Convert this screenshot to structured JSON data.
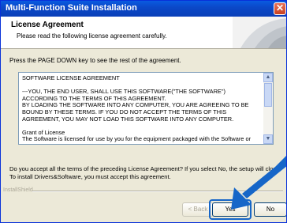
{
  "window": {
    "title": "Multi-Function Suite Installation",
    "close_glyph": "✕"
  },
  "header": {
    "title": "License Agreement",
    "subtitle": "Please read the following license agreement carefully."
  },
  "instruction": "Press the PAGE DOWN key to see the rest of the agreement.",
  "license_text": "SOFTWARE LICENSE AGREEMENT\n\n---YOU, THE END USER, SHALL USE THIS SOFTWARE(\"THE SOFTWARE\")\nACCORDING TO THE TERMS OF THIS AGREEMENT.\nBY LOADING THE SOFTWARE INTO ANY COMPUTER, YOU ARE AGREEING TO BE\nBOUND BY THESE TERMS. IF YOU DO NOT ACCEPT THE TERMS OF THIS\nAGREEMENT, YOU MAY NOT LOAD THIS SOFTWARE INTO ANY COMPUTER.\n\nGrant of License\nThe Software is licensed for use by you for the equipment packaged with the Software or",
  "question": "Do you accept all the terms of the preceding License Agreement?  If you select No,  the setup will close.  To install Drivers&Software, you must accept this agreement.",
  "brand": "InstallShield",
  "buttons": {
    "back": "< Back",
    "yes": "Yes",
    "no": "No"
  },
  "icons": {
    "close": "close-icon",
    "scroll_up": "scroll-up-arrow-icon",
    "scroll_down": "scroll-down-arrow-icon",
    "pointer": "pointer-arrow-icon"
  },
  "colors": {
    "titlebar": "#0b48c8",
    "close": "#c8401f",
    "arrow": "#1666c8"
  }
}
